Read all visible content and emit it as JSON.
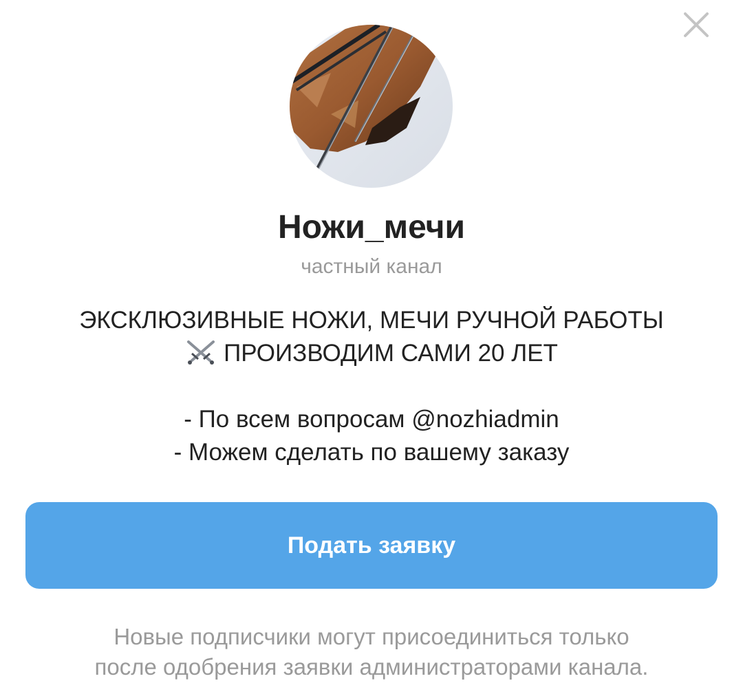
{
  "dialog": {
    "close_icon": "close-icon",
    "avatar_icon": "channel-avatar-photo"
  },
  "channel": {
    "title": "Ножи_мечи",
    "subtitle": "частный канал"
  },
  "description": {
    "line1": "ЭКСКЛЮЗИВНЫЕ НОЖИ, МЕЧИ РУЧНОЙ РАБОТЫ",
    "line2_icon": "crossed-swords-icon",
    "line2": "ПРОИЗВОДИМ САМИ 20 ЛЕТ",
    "line3": "- По всем вопросам @nozhiadmin",
    "line4": "- Можем сделать по вашему заказу"
  },
  "action": {
    "join_label": "Подать заявку"
  },
  "footnote": {
    "line1": "Новые подписчики могут присоединиться только",
    "line2": "после одобрения заявки администраторами канала."
  },
  "colors": {
    "accent": "#54a5e8",
    "title": "#222222",
    "secondary": "#9a9a9a"
  }
}
